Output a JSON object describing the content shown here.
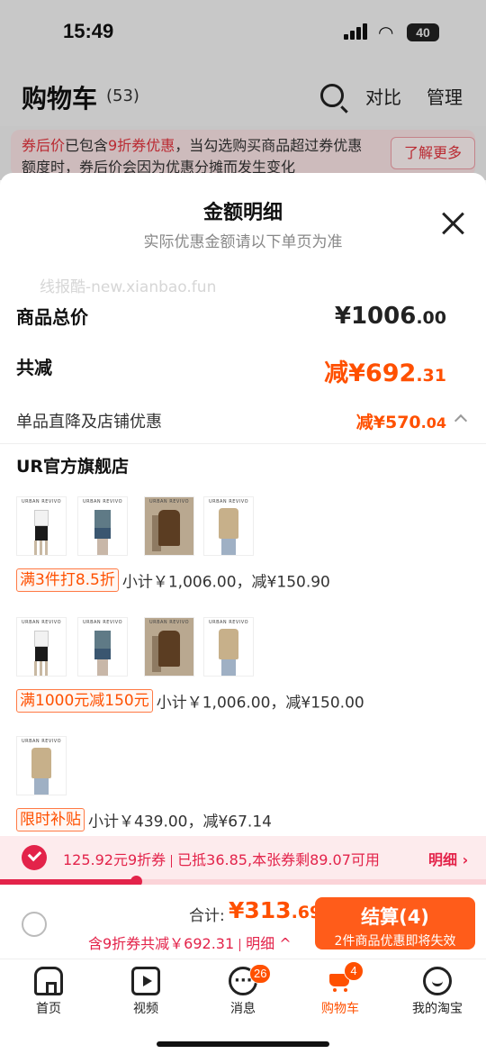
{
  "status": {
    "time": "15:49",
    "battery": "40"
  },
  "cart": {
    "title": "购物车",
    "count": "(53)",
    "compare": "对比",
    "manage": "管理",
    "notice_red1": "券后价",
    "notice_mid": "已包含",
    "notice_red2": "9折券优惠",
    "notice_rest": "，当勾选购买商品超过券优惠额度时，券后价会因为优惠分摊而发生变化",
    "learn_more": "了解更多"
  },
  "sheet": {
    "title": "金额明细",
    "subtitle": "实际优惠金额请以下单页为准",
    "watermark": "线报酷-new.xianbao.fun",
    "total_label": "商品总价",
    "total_int": "¥1006",
    "total_dec": ".00",
    "reduce_label": "共减",
    "reduce_int": "减¥692",
    "reduce_dec": ".31",
    "shop_discount_label": "单品直降及店铺优惠",
    "shop_discount_int": "减¥570",
    "shop_discount_dec": ".04",
    "shop_name": "UR官方旗舰店",
    "thumb_brand": "URBAN REVIVO",
    "promos": [
      {
        "tag": "满3件打8.5折",
        "summary": "小计￥1,006.00，减¥150.90"
      },
      {
        "tag": "满1000元减150元",
        "summary": "小计￥1,006.00，减¥150.00"
      },
      {
        "tag": "限时补贴",
        "summary": "小计￥439.00，减¥67.14"
      }
    ]
  },
  "coupon": {
    "left": "125.92元9折券",
    "right": "已抵36.85,本张券剩89.07可用",
    "detail": "明细 ›",
    "progress": 0.28
  },
  "checkout": {
    "sum_label": "合计:",
    "sum_int": "¥313",
    "sum_dec": ".69",
    "saving_text": "含9折券共减￥692.31",
    "saving_detail": "明细 ^",
    "pay_label": "结算(4)",
    "pay_sub": "2件商品优惠即将失效"
  },
  "tabs": [
    {
      "label": "首页",
      "icon": "home-icon"
    },
    {
      "label": "视频",
      "icon": "video-icon"
    },
    {
      "label": "消息",
      "icon": "message-icon",
      "badge": "26"
    },
    {
      "label": "购物车",
      "icon": "cart-icon",
      "badge": "4",
      "active": true
    },
    {
      "label": "我的淘宝",
      "icon": "profile-icon"
    }
  ],
  "colors": {
    "accent": "#ff5000",
    "coupon_red": "#e3234a"
  }
}
